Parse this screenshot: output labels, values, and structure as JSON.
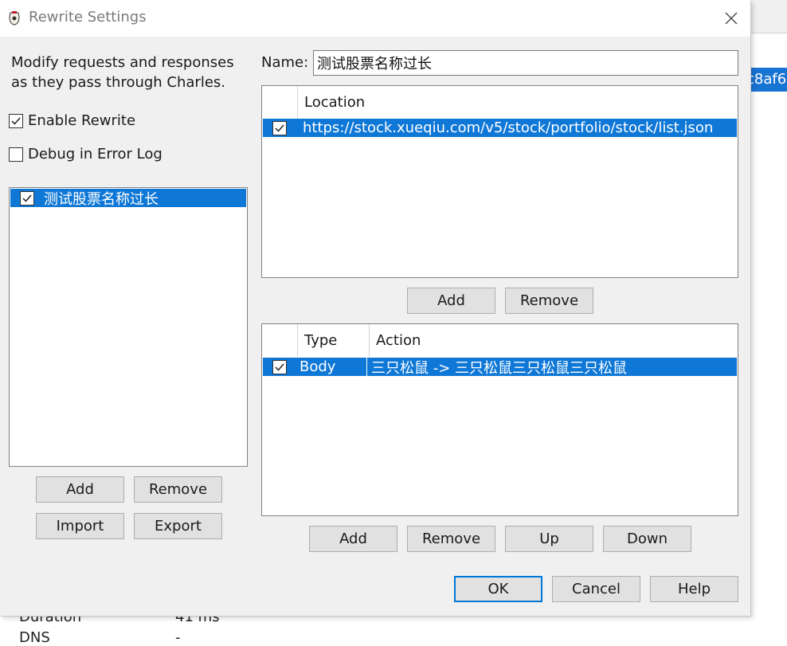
{
  "background": {
    "blue_text": "c8af6",
    "rows": [
      {
        "label": "Duration",
        "value": "41 ms"
      },
      {
        "label": "DNS",
        "value": "-"
      }
    ]
  },
  "dialog": {
    "title": "Rewrite Settings",
    "description": "Modify requests and responses as they pass through Charles.",
    "enable_rewrite": {
      "label": "Enable Rewrite",
      "checked": true
    },
    "debug_log": {
      "label": "Debug in Error Log",
      "checked": false
    },
    "sets": [
      {
        "name": "测试股票名称过长",
        "enabled": true,
        "selected": true
      }
    ],
    "sets_buttons": {
      "add": "Add",
      "remove": "Remove",
      "import": "Import",
      "export": "Export"
    },
    "name_label": "Name:",
    "name_value": "测试股票名称过长",
    "locations": {
      "header": "Location",
      "rows": [
        {
          "enabled": true,
          "url": "https://stock.xueqiu.com/v5/stock/portfolio/stock/list.json",
          "selected": true
        }
      ],
      "buttons": {
        "add": "Add",
        "remove": "Remove"
      }
    },
    "rules": {
      "headers": {
        "type": "Type",
        "action": "Action"
      },
      "rows": [
        {
          "enabled": true,
          "type": "Body",
          "action": "三只松鼠 -> 三只松鼠三只松鼠三只松鼠",
          "selected": true
        }
      ],
      "buttons": {
        "add": "Add",
        "remove": "Remove",
        "up": "Up",
        "down": "Down"
      }
    },
    "footer": {
      "ok": "OK",
      "cancel": "Cancel",
      "help": "Help"
    }
  },
  "colors": {
    "selection": "#0f78d7",
    "dialog_bg": "#f0f0f0",
    "default_button_border": "#0078d7"
  }
}
